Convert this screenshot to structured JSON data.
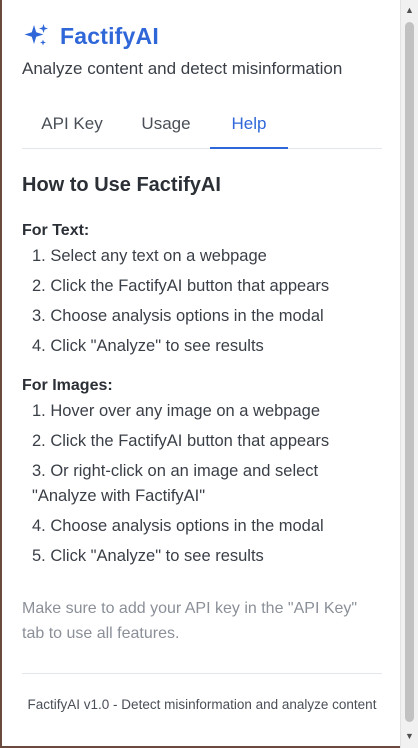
{
  "app": {
    "name": "FactifyAI",
    "subtitle": "Analyze content and detect misinformation",
    "icon": "sparkles-icon",
    "accent_color": "#2f67d8"
  },
  "tabs": [
    {
      "label": "API Key",
      "active": false
    },
    {
      "label": "Usage",
      "active": false
    },
    {
      "label": "Help",
      "active": true
    }
  ],
  "help": {
    "title": "How to Use FactifyAI",
    "text_section": {
      "heading": "For Text:",
      "steps": [
        "1. Select any text on a webpage",
        "2. Click the FactifyAI button that appears",
        "3. Choose analysis options in the modal",
        "4. Click \"Analyze\" to see results"
      ]
    },
    "image_section": {
      "heading": "For Images:",
      "steps": [
        "1. Hover over any image on a webpage",
        "2. Click the FactifyAI button that appears",
        "3. Or right-click on an image and select \"Analyze with FactifyAI\"",
        "4. Choose analysis options in the modal",
        "5. Click \"Analyze\" to see results"
      ]
    },
    "note": "Make sure to add your API key in the \"API Key\" tab to use all features."
  },
  "footer": {
    "text": "FactifyAI v1.0 - Detect misinformation and analyze content"
  }
}
